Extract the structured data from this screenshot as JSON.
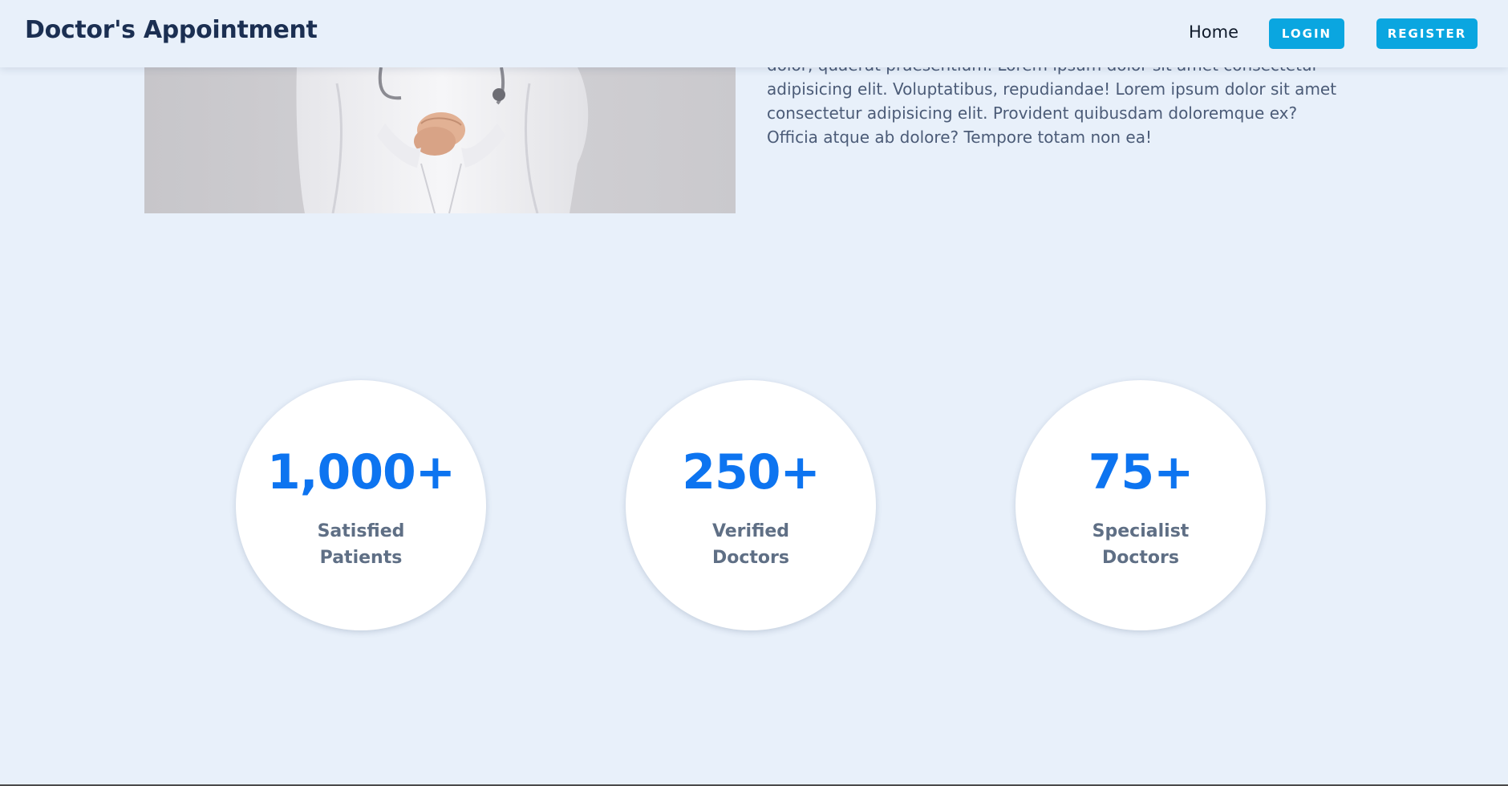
{
  "header": {
    "brand": "Doctor's Appointment",
    "nav_home": "Home",
    "login_label": "LOGIN",
    "register_label": "REGISTER"
  },
  "hero": {
    "text_lines": [
      "dolor, quaerat praesentium. Lorem ipsum dolor sit amet consectetur",
      "adipisicing elit. Voluptatibus, repudiandae! Lorem ipsum dolor sit amet",
      "consectetur adipisicing elit. Provident quibusdam doloremque ex?",
      "Officia atque ab dolore? Tempore totam non ea!"
    ]
  },
  "stats": [
    {
      "value": "1,000+",
      "label_line1": "Satisfied",
      "label_line2": "Patients"
    },
    {
      "value": "250+",
      "label_line1": "Verified",
      "label_line2": "Doctors"
    },
    {
      "value": "75+",
      "label_line1": "Specialist",
      "label_line2": "Doctors"
    }
  ],
  "colors": {
    "page_bg": "#e8f0fa",
    "brand_text": "#1b2f52",
    "button_bg": "#0aa6e0",
    "stat_value": "#0d74f0",
    "stat_label": "#5f6f85"
  }
}
